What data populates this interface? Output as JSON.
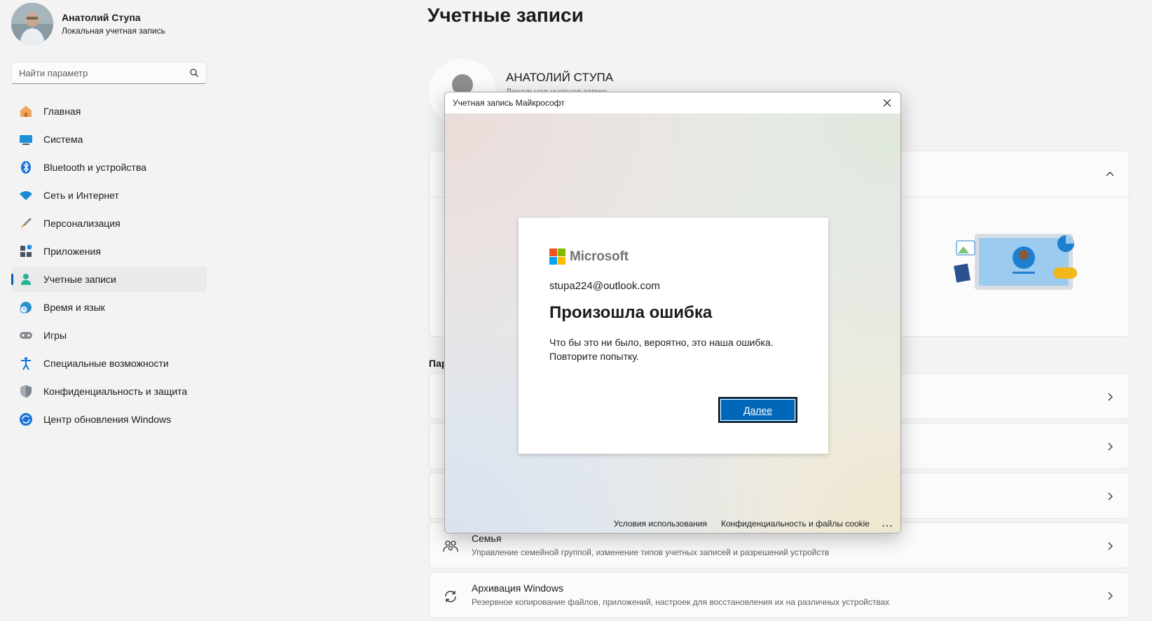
{
  "profile": {
    "name": "Анатолий Ступа",
    "subtitle": "Локальная учетная запись"
  },
  "search": {
    "placeholder": "Найти параметр"
  },
  "nav": [
    {
      "label": "Главная",
      "icon": "home-icon"
    },
    {
      "label": "Система",
      "icon": "monitor-icon"
    },
    {
      "label": "Bluetooth и устройства",
      "icon": "bluetooth-icon"
    },
    {
      "label": "Сеть и Интернет",
      "icon": "wifi-icon"
    },
    {
      "label": "Персонализация",
      "icon": "brush-icon"
    },
    {
      "label": "Приложения",
      "icon": "apps-icon"
    },
    {
      "label": "Учетные записи",
      "icon": "person-icon",
      "active": true
    },
    {
      "label": "Время и язык",
      "icon": "globe-clock-icon"
    },
    {
      "label": "Игры",
      "icon": "gamepad-icon"
    },
    {
      "label": "Специальные возможности",
      "icon": "accessibility-icon"
    },
    {
      "label": "Конфиденциальность и защита",
      "icon": "shield-icon"
    },
    {
      "label": "Центр обновления Windows",
      "icon": "update-icon"
    }
  ],
  "main": {
    "title": "Учетные записи",
    "account_name": "АНАТОЛИЙ СТУПА",
    "account_sub": "Локальная учетная запись",
    "section_label": "Пар",
    "rows": [
      {
        "title": "Семья",
        "desc": "Управление семейной группой, изменение типов учетных записей и разрешений устройств",
        "icon": "family-icon"
      },
      {
        "title": "Архивация Windows",
        "desc": "Резервное копирование файлов, приложений, настроек для восстановления их на различных устройствах",
        "icon": "sync-icon"
      }
    ]
  },
  "dialog": {
    "title": "Учетная запись Майкрософт",
    "logo_text": "Microsoft",
    "email": "stupa224@outlook.com",
    "heading": "Произошла ошибка",
    "message": "Что бы это ни было, вероятно, это наша ошибка. Повторите попытку.",
    "next_label": "Далее",
    "footer_terms": "Условия использования",
    "footer_privacy": "Конфиденциальность и файлы cookie",
    "footer_more": "...",
    "logo_colors": [
      "#f25022",
      "#7fba00",
      "#00a4ef",
      "#ffb900"
    ]
  }
}
